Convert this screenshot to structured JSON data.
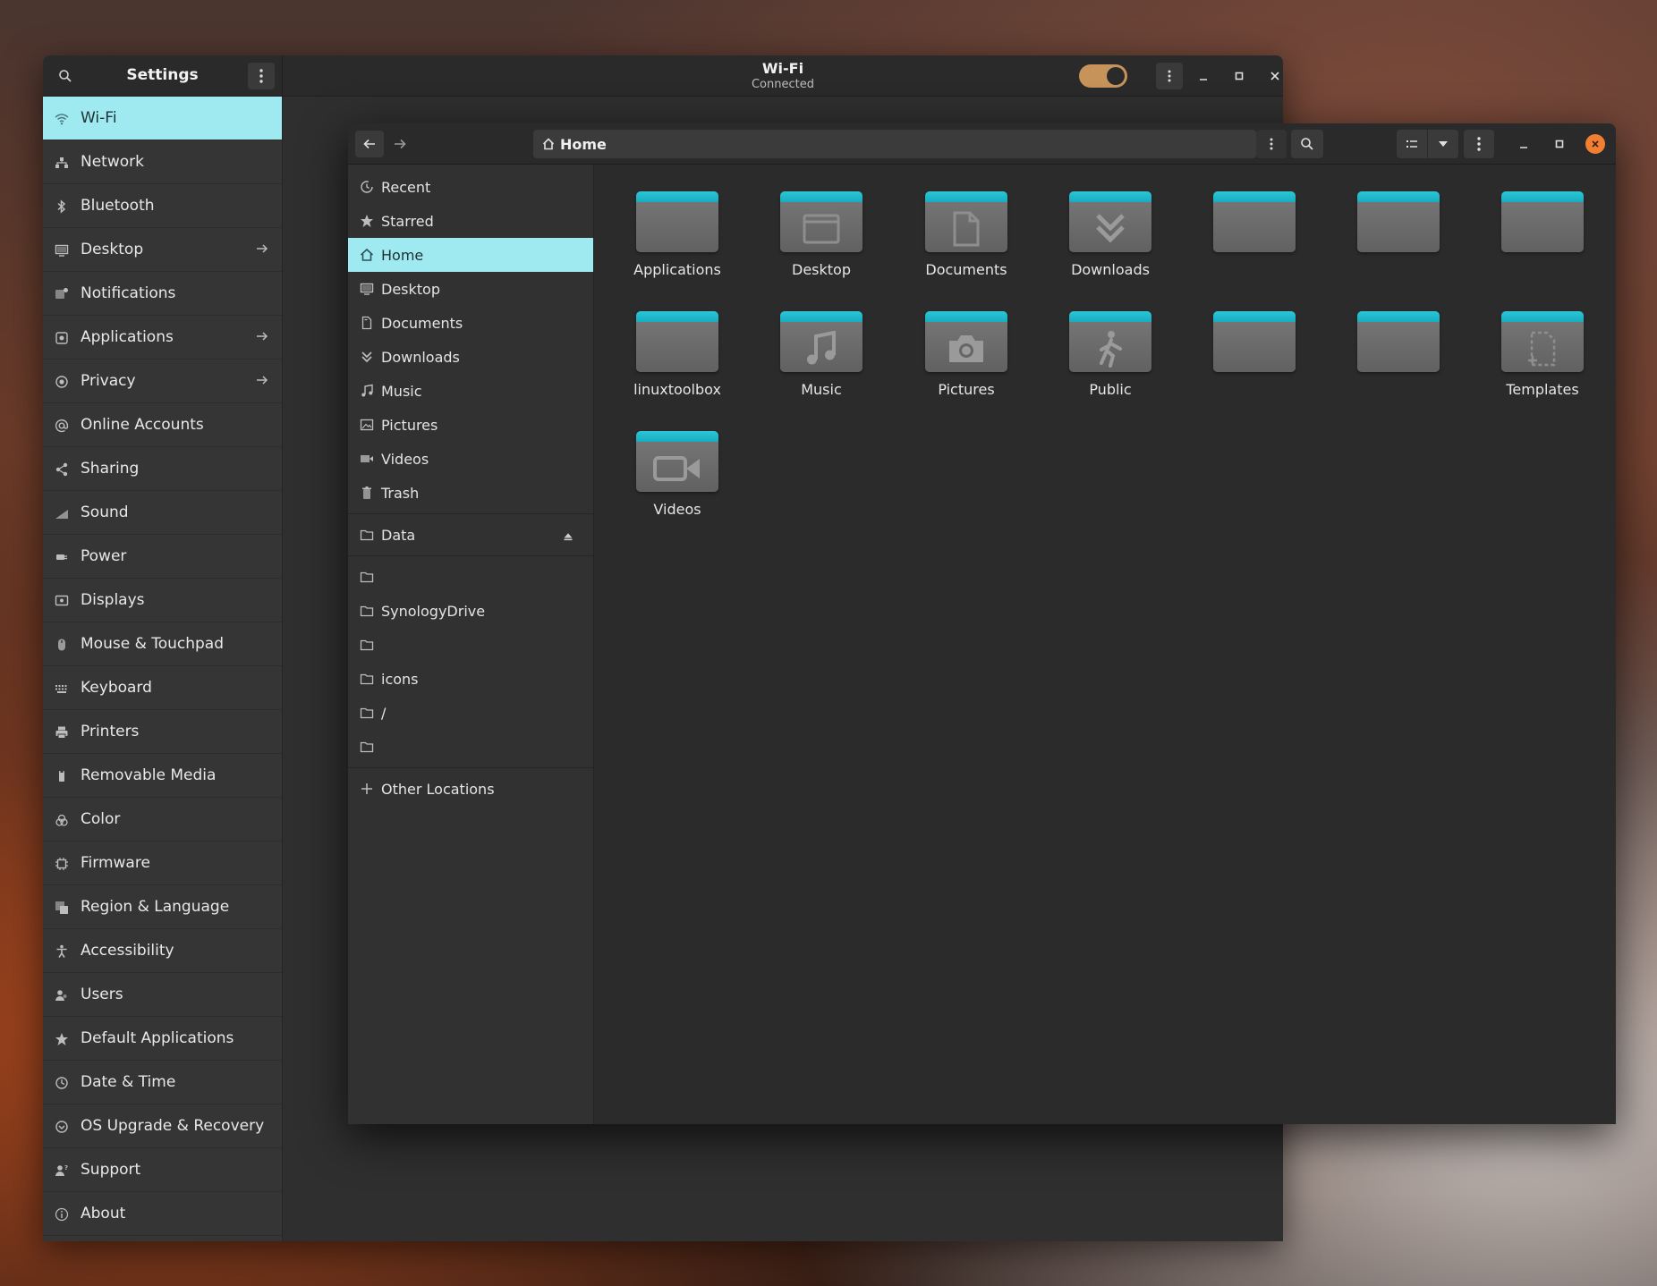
{
  "settings": {
    "title": "Settings",
    "panel_title": "Wi-Fi",
    "panel_status": "Connected",
    "wifi_toggle_on": true,
    "sidebar": [
      {
        "label": "Wi-Fi",
        "icon": "wifi-icon",
        "active": true
      },
      {
        "label": "Network",
        "icon": "network-icon"
      },
      {
        "label": "Bluetooth",
        "icon": "bluetooth-icon"
      },
      {
        "label": "Desktop",
        "icon": "desktop-icon",
        "arrow": true
      },
      {
        "label": "Notifications",
        "icon": "notifications-icon"
      },
      {
        "label": "Applications",
        "icon": "applications-icon",
        "arrow": true
      },
      {
        "label": "Privacy",
        "icon": "privacy-icon",
        "arrow": true
      },
      {
        "label": "Online Accounts",
        "icon": "at-icon"
      },
      {
        "label": "Sharing",
        "icon": "share-icon"
      },
      {
        "label": "Sound",
        "icon": "sound-icon"
      },
      {
        "label": "Power",
        "icon": "power-icon"
      },
      {
        "label": "Displays",
        "icon": "display-icon"
      },
      {
        "label": "Mouse & Touchpad",
        "icon": "mouse-icon"
      },
      {
        "label": "Keyboard",
        "icon": "keyboard-icon"
      },
      {
        "label": "Printers",
        "icon": "printer-icon"
      },
      {
        "label": "Removable Media",
        "icon": "usb-icon"
      },
      {
        "label": "Color",
        "icon": "color-icon"
      },
      {
        "label": "Firmware",
        "icon": "chip-icon"
      },
      {
        "label": "Region & Language",
        "icon": "language-icon"
      },
      {
        "label": "Accessibility",
        "icon": "accessibility-icon"
      },
      {
        "label": "Users",
        "icon": "users-icon"
      },
      {
        "label": "Default Applications",
        "icon": "star-icon"
      },
      {
        "label": "Date & Time",
        "icon": "clock-icon"
      },
      {
        "label": "OS Upgrade & Recovery",
        "icon": "upgrade-icon"
      },
      {
        "label": "Support",
        "icon": "support-icon"
      },
      {
        "label": "About",
        "icon": "info-icon"
      }
    ]
  },
  "files": {
    "path": "Home",
    "sidebar_places": [
      {
        "label": "Recent",
        "icon": "recent-icon"
      },
      {
        "label": "Starred",
        "icon": "star-icon"
      },
      {
        "label": "Home",
        "icon": "home-icon",
        "active": true
      },
      {
        "label": "Desktop",
        "icon": "desktop-icon"
      },
      {
        "label": "Documents",
        "icon": "document-icon"
      },
      {
        "label": "Downloads",
        "icon": "download-icon"
      },
      {
        "label": "Music",
        "icon": "music-icon"
      },
      {
        "label": "Pictures",
        "icon": "picture-icon"
      },
      {
        "label": "Videos",
        "icon": "video-icon"
      },
      {
        "label": "Trash",
        "icon": "trash-icon"
      }
    ],
    "sidebar_devices": [
      {
        "label": "Data",
        "icon": "folder-icon",
        "eject": true
      }
    ],
    "sidebar_bookmarks": [
      {
        "label": "",
        "icon": "folder-icon"
      },
      {
        "label": "SynologyDrive",
        "icon": "folder-icon"
      },
      {
        "label": "",
        "icon": "folder-icon"
      },
      {
        "label": "icons",
        "icon": "folder-icon"
      },
      {
        "label": "/",
        "icon": "folder-icon"
      },
      {
        "label": "",
        "icon": "folder-icon"
      }
    ],
    "other_locations": "Other Locations",
    "items": [
      {
        "label": "Applications",
        "emblem": "none"
      },
      {
        "label": "Desktop",
        "emblem": "desktop"
      },
      {
        "label": "Documents",
        "emblem": "document"
      },
      {
        "label": "Downloads",
        "emblem": "download"
      },
      {
        "label": "",
        "emblem": "none"
      },
      {
        "label": "",
        "emblem": "none"
      },
      {
        "label": "",
        "emblem": "none"
      },
      {
        "label": "linuxtoolbox",
        "emblem": "none"
      },
      {
        "label": "Music",
        "emblem": "music"
      },
      {
        "label": "Pictures",
        "emblem": "camera"
      },
      {
        "label": "Public",
        "emblem": "public"
      },
      {
        "label": "",
        "emblem": "none"
      },
      {
        "label": "",
        "emblem": "none"
      },
      {
        "label": "Templates",
        "emblem": "template"
      },
      {
        "label": "Videos",
        "emblem": "video"
      }
    ]
  },
  "colors": {
    "accent": "#9eeaf0",
    "folder_tab": "#1fb8ca",
    "toggle": "#c6935a",
    "close": "#f07f34"
  }
}
